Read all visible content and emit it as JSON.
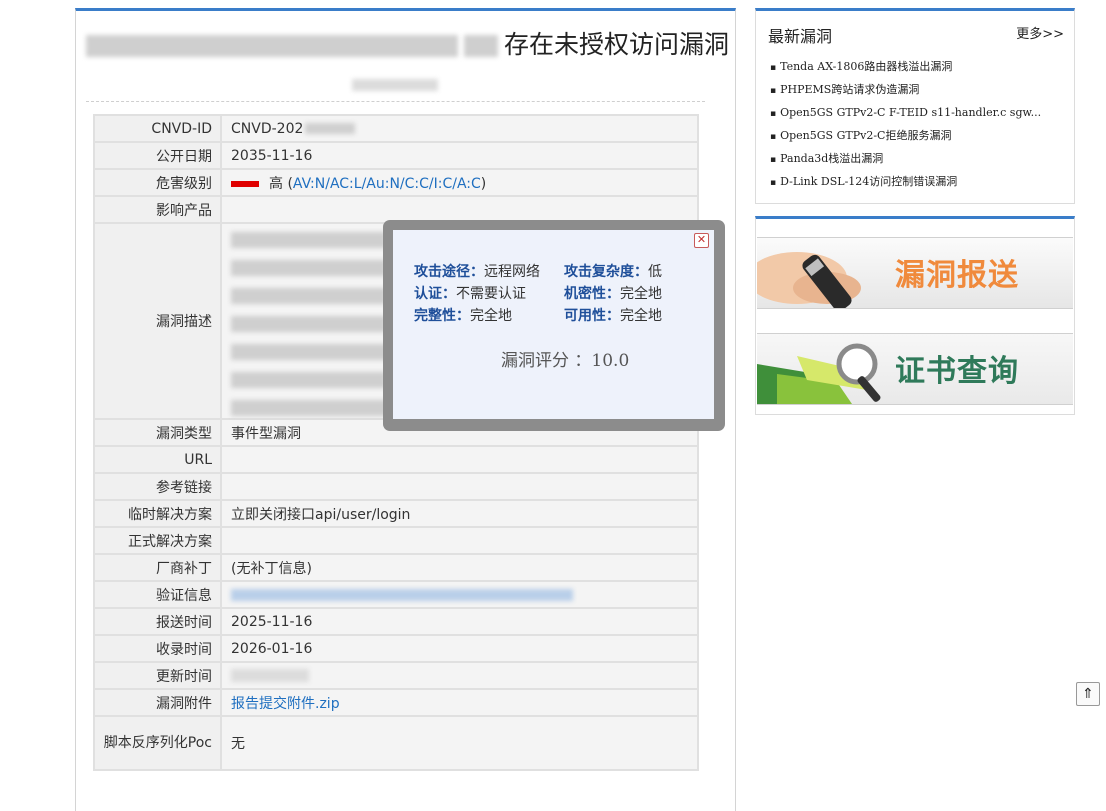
{
  "article": {
    "title_suffix": "存在未授权访问漏洞"
  },
  "details": {
    "cnvd_id_label": "CNVD-ID",
    "cnvd_id_value": "CNVD-202",
    "public_date_label": "公开日期",
    "public_date_value": "2035-11-16",
    "severity_label": "危害级别",
    "severity_value": "高 (",
    "severity_vector": "AV:N/AC:L/Au:N/C:C/I:C/A:C",
    "severity_close": ")",
    "severity_color": "#e00000",
    "product_label": "影响产品",
    "description_label": "漏洞描述",
    "type_label": "漏洞类型",
    "type_value": "事件型漏洞",
    "url_label": "URL",
    "ref_label": "参考链接",
    "temp_fix_label": "临时解决方案",
    "temp_fix_value": "立即关闭接口api/user/login",
    "formal_fix_label": "正式解决方案",
    "patch_label": "厂商补丁",
    "patch_value": "(无补丁信息)",
    "verify_label": "验证信息",
    "submit_label": "报送时间",
    "submit_value": "2025-11-16",
    "record_label": "收录时间",
    "record_value": "2026-01-16",
    "update_label": "更新时间",
    "attachment_label": "漏洞附件",
    "attachment_value": "报告提交附件.zip",
    "poc_label": "脚本反序列化Poc",
    "poc_value": "无"
  },
  "popup": {
    "close_glyph": "✕",
    "attack_vector_label": "攻击途径：",
    "attack_vector_value": "远程网络",
    "attack_complexity_label": "攻击复杂度：",
    "attack_complexity_value": "低",
    "auth_label": "认证：",
    "auth_value": "不需要认证",
    "confidentiality_label": "机密性：",
    "confidentiality_value": "完全地",
    "integrity_label": "完整性：",
    "integrity_value": "完全地",
    "availability_label": "可用性：",
    "availability_value": "完全地",
    "score_text": "漏洞评分 ：10.0"
  },
  "sidebar": {
    "title": "最新漏洞",
    "more": "更多>>",
    "items": [
      "Tenda AX-1806路由器栈溢出漏洞",
      "PHPEMS跨站请求伪造漏洞",
      "Open5GS GTPv2-C F-TEID s11-handler.c sgw...",
      "Open5GS GTPv2-C拒绝服务漏洞",
      "Panda3d栈溢出漏洞",
      "D-Link DSL-124访问控制错误漏洞"
    ]
  },
  "banners": {
    "report": "漏洞报送",
    "certificate": "证书查询"
  },
  "back_to_top": "⇑"
}
